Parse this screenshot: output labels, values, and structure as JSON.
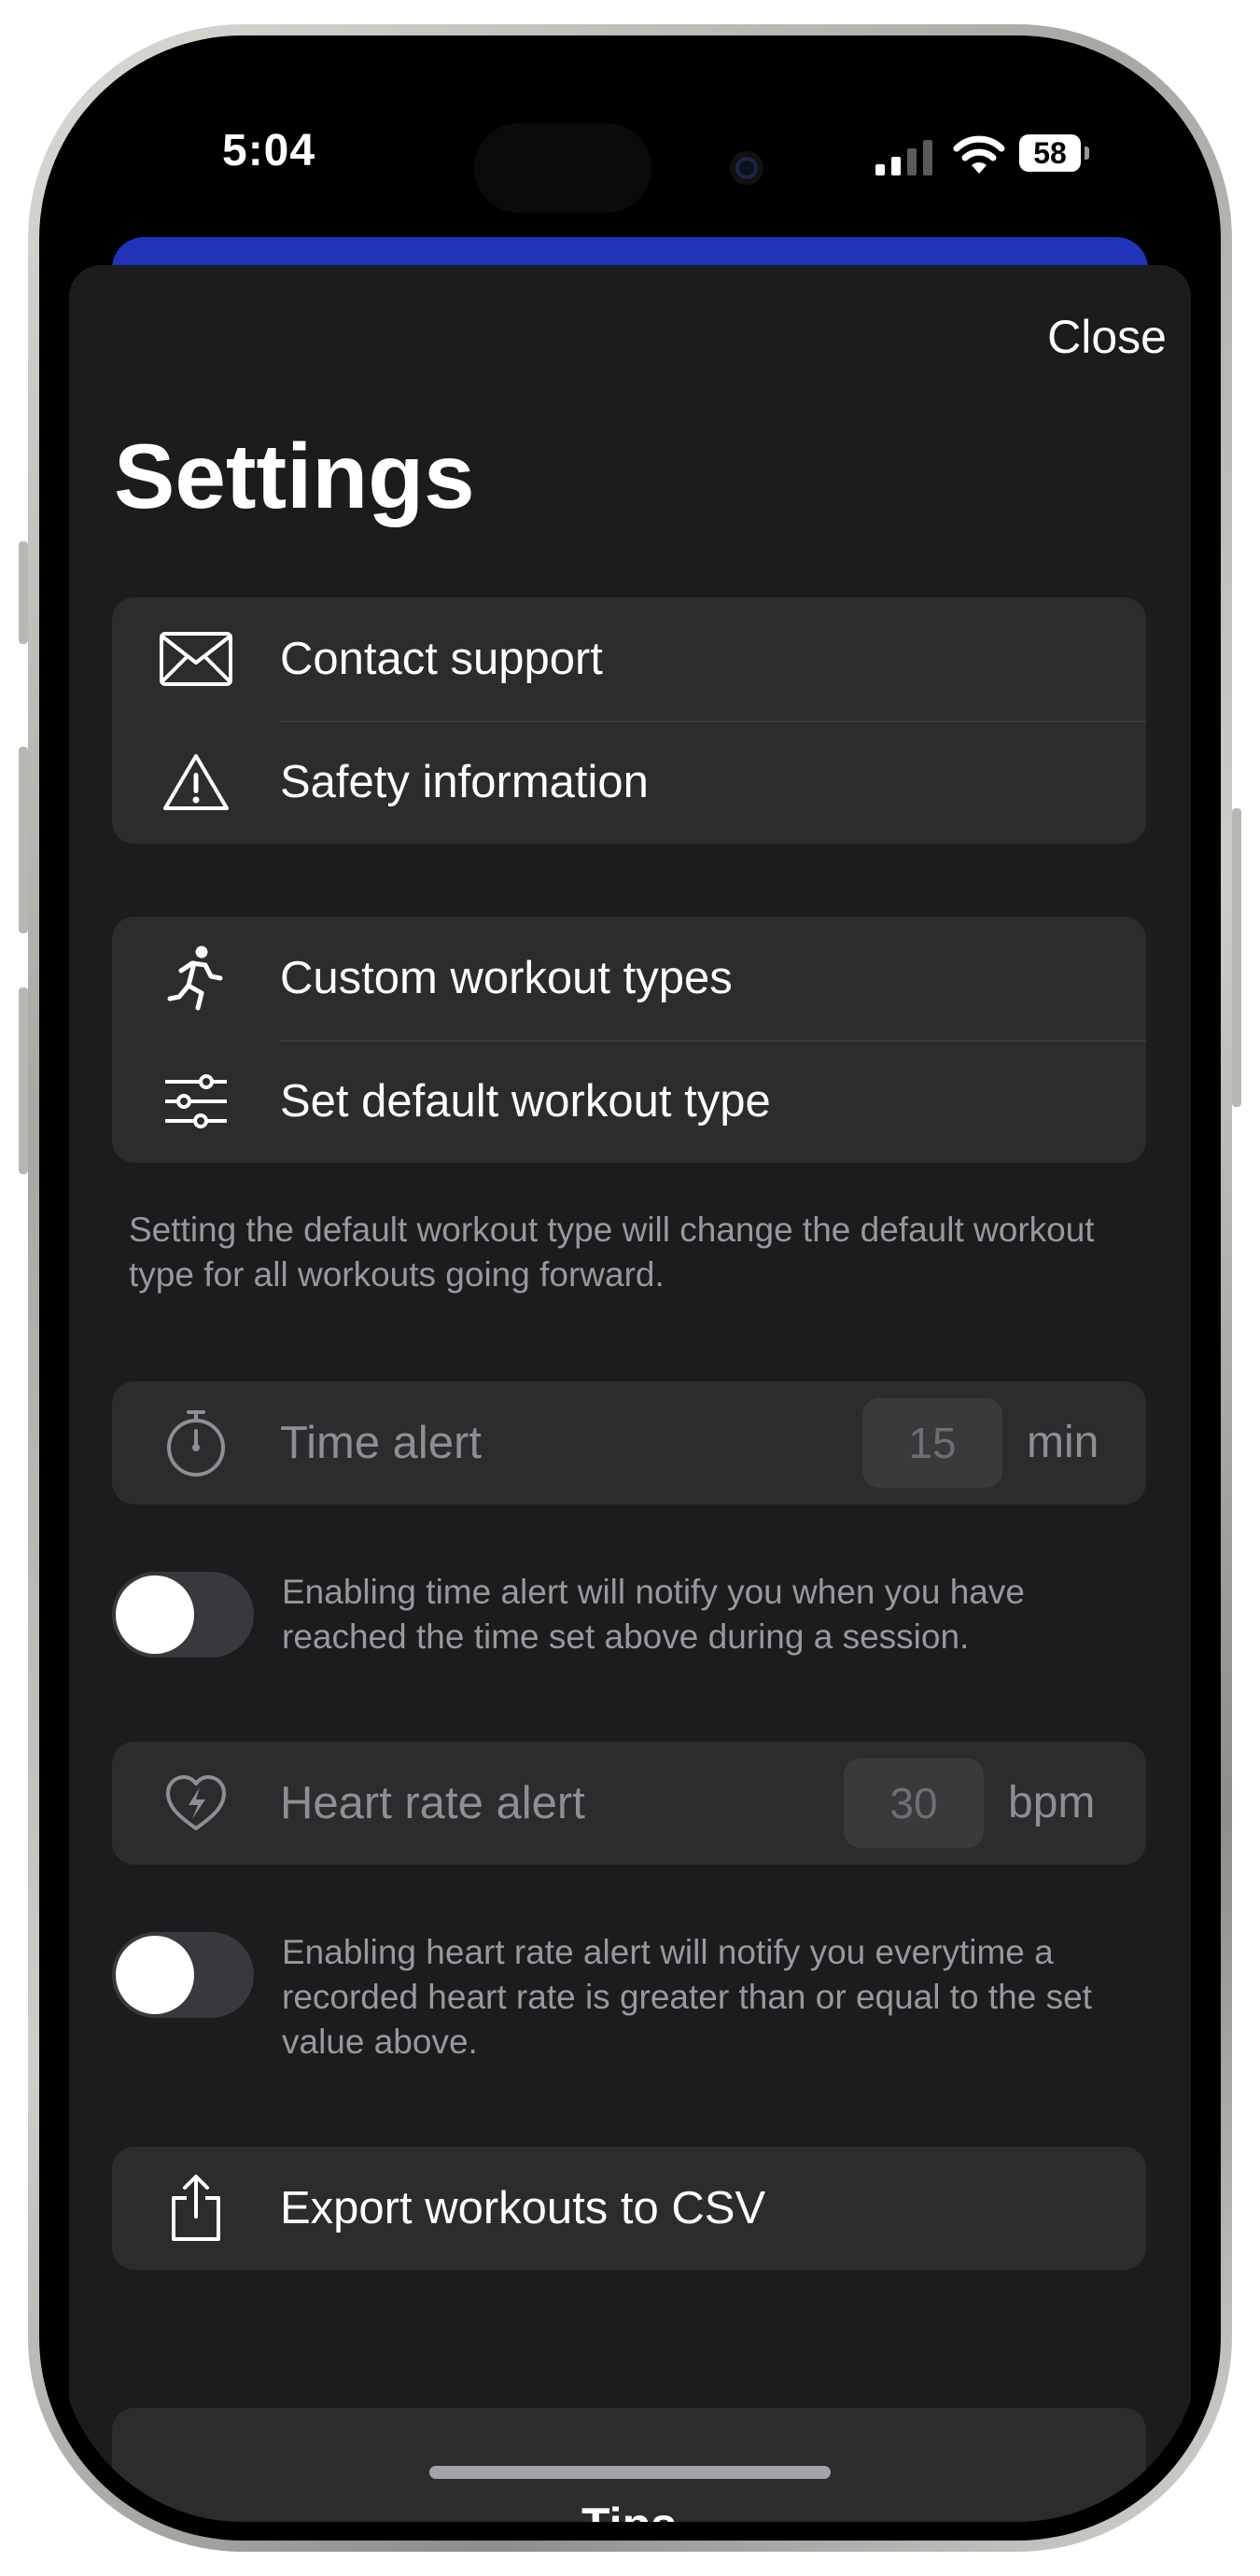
{
  "status_bar": {
    "time": "5:04",
    "battery": "58"
  },
  "sheet": {
    "close_label": "Close",
    "title": "Settings"
  },
  "support_group": [
    {
      "icon": "envelope-icon",
      "label": "Contact support"
    },
    {
      "icon": "warning-triangle-icon",
      "label": "Safety information"
    }
  ],
  "workout_group": [
    {
      "icon": "running-figure-icon",
      "label": "Custom workout types"
    },
    {
      "icon": "sliders-icon",
      "label": "Set default workout type"
    }
  ],
  "workout_note": "Setting the default workout type will change the default workout type for all workouts going forward.",
  "time_alert": {
    "icon": "stopwatch-icon",
    "label": "Time alert",
    "value": "15",
    "unit": "min",
    "enabled": false,
    "note": "Enabling time alert will notify you when you have reached the time set above during a session."
  },
  "heart_rate_alert": {
    "icon": "heart-bolt-icon",
    "label": "Heart rate alert",
    "value": "30",
    "unit": "bpm",
    "enabled": false,
    "note": "Enabling heart rate alert will notify you everytime a recorded heart rate is greater than or equal to the set value above."
  },
  "export": {
    "icon": "share-icon",
    "label": "Export workouts to CSV"
  },
  "tips": {
    "label": "Tips"
  },
  "colors": {
    "sheet_background": "#1c1c1e",
    "cell_background": "#2c2c2e",
    "accent_behind_sheet": "#1f34b9"
  }
}
